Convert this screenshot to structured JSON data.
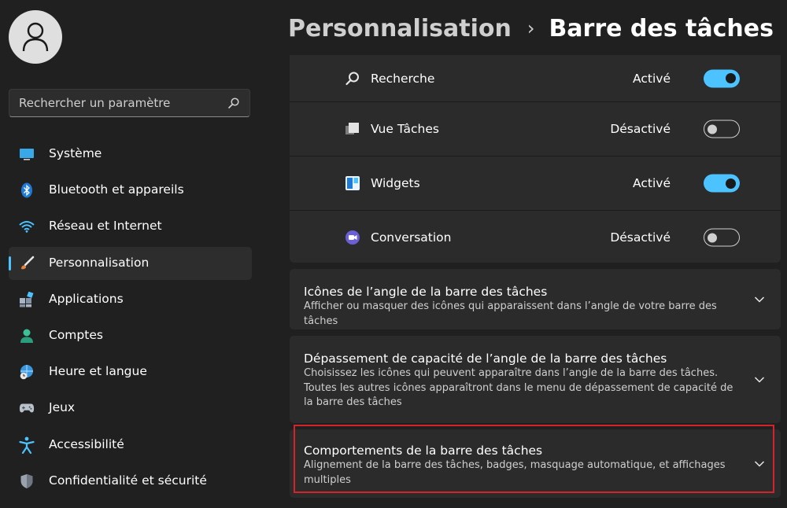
{
  "sidebar": {
    "search_placeholder": "Rechercher un paramètre",
    "items": [
      {
        "label": "Système",
        "icon": "monitor-icon"
      },
      {
        "label": "Bluetooth et appareils",
        "icon": "bluetooth-icon"
      },
      {
        "label": "Réseau et Internet",
        "icon": "wifi-icon"
      },
      {
        "label": "Personnalisation",
        "icon": "brush-icon",
        "selected": true
      },
      {
        "label": "Applications",
        "icon": "apps-icon"
      },
      {
        "label": "Comptes",
        "icon": "person-icon"
      },
      {
        "label": "Heure et langue",
        "icon": "globe-clock-icon"
      },
      {
        "label": "Jeux",
        "icon": "gamepad-icon"
      },
      {
        "label": "Accessibilité",
        "icon": "accessibility-icon"
      },
      {
        "label": "Confidentialité et sécurité",
        "icon": "shield-icon"
      }
    ]
  },
  "header": {
    "parent": "Personnalisation",
    "separator": "›",
    "current": "Barre des tâches"
  },
  "taskbar_items": [
    {
      "label": "Recherche",
      "state": "Activé",
      "on": true,
      "icon": "search-icon"
    },
    {
      "label": "Vue Tâches",
      "state": "Désactivé",
      "on": false,
      "icon": "task-view-icon"
    },
    {
      "label": "Widgets",
      "state": "Activé",
      "on": true,
      "icon": "widgets-icon"
    },
    {
      "label": "Conversation",
      "state": "Désactivé",
      "on": false,
      "icon": "chat-icon"
    }
  ],
  "sections": [
    {
      "title": "Icônes de l’angle de la barre des tâches",
      "desc": "Afficher ou masquer des icônes qui apparaissent dans l’angle de votre barre des tâches"
    },
    {
      "title": "Dépassement de capacité de l’angle de la barre des tâches",
      "desc": "Choisissez les icônes qui peuvent apparaître dans l’angle de la barre des tâches. Toutes les autres icônes apparaîtront dans le menu de dépassement de capacité de la barre des tâches"
    },
    {
      "title": "Comportements de la barre des tâches",
      "desc": "Alignement de la barre des tâches, badges, masquage automatique, et affichages multiples"
    }
  ],
  "colors": {
    "accent": "#4cc2ff",
    "highlight": "#d4232b",
    "background": "#202020",
    "card": "#2b2b2b"
  }
}
